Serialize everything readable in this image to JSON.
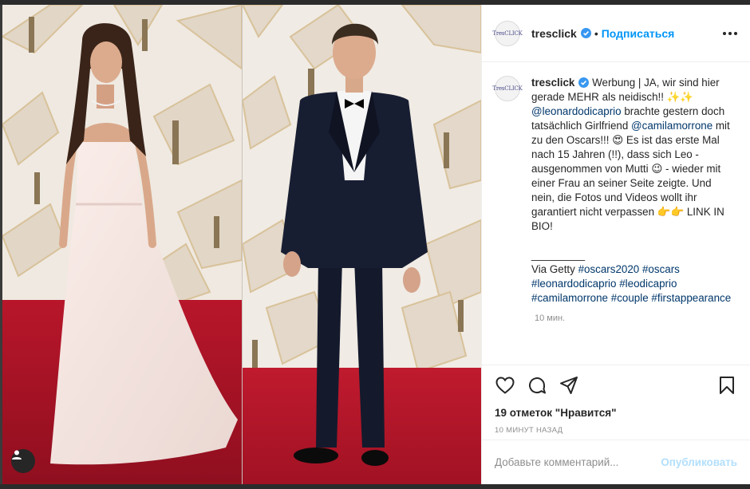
{
  "post": {
    "username": "tresclick",
    "avatar_text": "TresCLICK",
    "follow_label": "Подписаться",
    "separator": "•",
    "more_icon": "more-dots-icon",
    "verified_icon": "verified-badge-icon",
    "caption": {
      "lines": [
        {
          "text": "Werbung | JA, wir sind hier gerade MEHR als neidisch!! ✨✨"
        },
        {
          "link": "@leonardodicaprio",
          "text": " brachte gestern doch tatsächlich Girlfriend "
        },
        {
          "link": "@camilamorrone",
          "text": " mit zu den Oscars!!! 😍 Es ist das erste Mal nach 15 Jahren (!!), dass sich Leo - ausgenommen von Mutti 😉 - wieder mit einer Frau an seiner Seite zeigte. Und nein, die Fotos und Videos wollt ihr garantiert nicht verpassen 👉👉 LINK IN BIO!"
        }
      ],
      "line_1": "Werbung | JA, wir sind hier gerade MEHR als neidisch!! ✨✨",
      "mention_1": "@leonardodicaprio",
      "line_2": " brachte gestern doch tatsächlich Girlfriend ",
      "mention_2": "@camilamorrone",
      "line_3": " mit zu den Oscars!!! 😍 Es ist das erste Mal nach 15 Jahren (!!), dass sich Leo - ausgenommen von Mutti 😉 - wieder mit einer Frau an seiner Seite zeigte. Und nein, die Fotos und Videos wollt ihr garantiert nicht verpassen 👉👉 LINK IN BIO!",
      "rule": "_________",
      "via": "Via Getty ",
      "hashtags": [
        "#oscars2020",
        "#oscars",
        "#leonardodicaprio",
        "#leodicaprio",
        "#camilamorrone",
        "#couple",
        "#firstappearance"
      ],
      "time": "10 мин."
    },
    "likes_text": "19 отметок \"Нравится\"",
    "timestamp": "10 МИНУТ НАЗАД",
    "comment_placeholder": "Добавьте комментарий...",
    "publish_label": "Опубликовать",
    "icons": [
      "heart-icon",
      "comment-icon",
      "share-icon",
      "bookmark-icon",
      "user-tag-icon"
    ]
  }
}
